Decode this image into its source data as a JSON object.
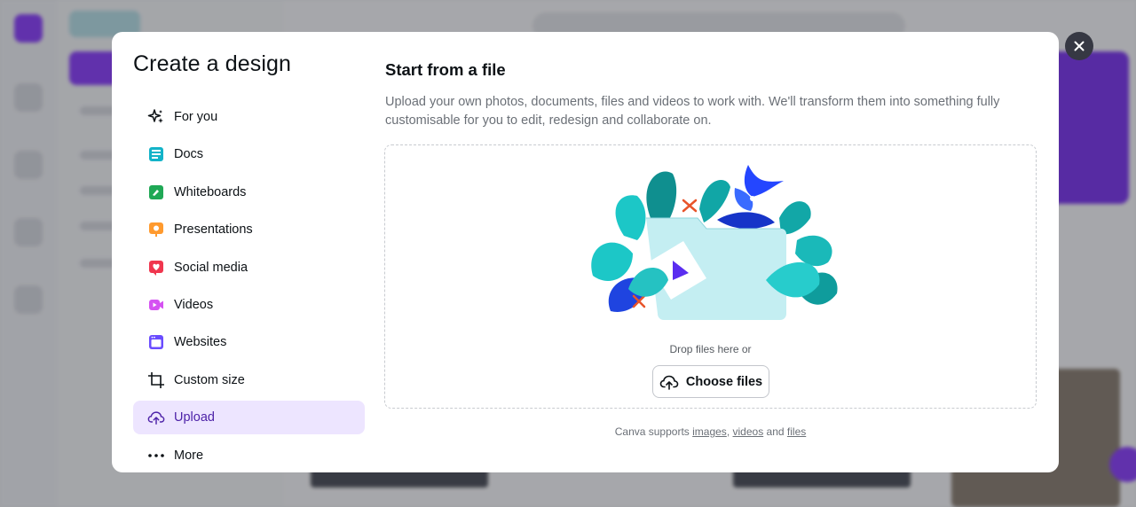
{
  "dialog": {
    "title": "Create a design",
    "close_icon": "close-icon"
  },
  "sidebar": {
    "items": [
      {
        "label": "For you",
        "icon": "sparkle-icon"
      },
      {
        "label": "Docs",
        "icon": "docs-icon"
      },
      {
        "label": "Whiteboards",
        "icon": "whiteboard-icon"
      },
      {
        "label": "Presentations",
        "icon": "presentation-icon"
      },
      {
        "label": "Social media",
        "icon": "heart-icon"
      },
      {
        "label": "Videos",
        "icon": "video-icon"
      },
      {
        "label": "Websites",
        "icon": "website-icon"
      },
      {
        "label": "Custom size",
        "icon": "crop-icon"
      },
      {
        "label": "Upload",
        "icon": "cloud-upload-icon",
        "selected": true
      },
      {
        "label": "More",
        "icon": "more-dots-icon"
      }
    ]
  },
  "upload_pane": {
    "title": "Start from a file",
    "description": "Upload your own photos, documents, files and videos to work with. We'll transform them into something fully customisable for you to edit, redesign and collaborate on.",
    "drop_text": "Drop files here or",
    "choose_button": "Choose files",
    "supports_prefix": "Canva supports",
    "supports_images": "images",
    "supports_comma": ",",
    "supports_videos": "videos",
    "supports_and": "and",
    "supports_files": "files"
  },
  "colors": {
    "accent": "#8b3dff",
    "selected_bg": "#ede5ff",
    "docs": "#13b3c8",
    "whiteboards": "#1fa855",
    "presentations": "#ff9a2e",
    "social": "#f0364e",
    "videos": "#d552f2",
    "websites": "#6a4cff"
  }
}
